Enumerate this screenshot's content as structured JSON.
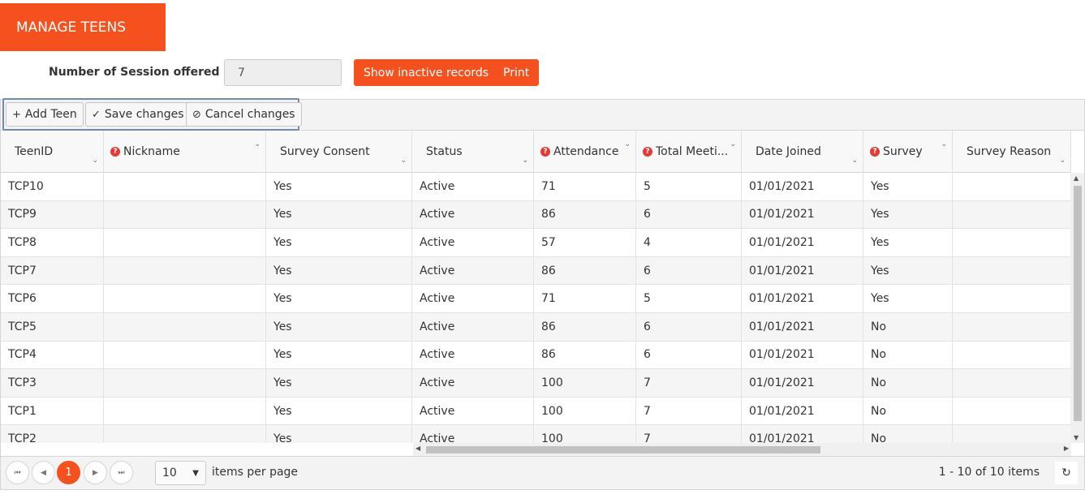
{
  "header": {
    "title": "MANAGE TEENS"
  },
  "session": {
    "label": "Number of Session offered",
    "value": "7"
  },
  "actions": {
    "show_inactive": "Show inactive records",
    "print": "Print"
  },
  "toolbar": {
    "add": "Add Teen",
    "save": "Save changes",
    "cancel": "Cancel changes"
  },
  "columns": [
    {
      "label": "TeenID",
      "required": false
    },
    {
      "label": "Nickname",
      "required": true
    },
    {
      "label": "Survey Consent",
      "required": false
    },
    {
      "label": "Status",
      "required": false
    },
    {
      "label": "Attendance",
      "required": true
    },
    {
      "label": "Total Meeti...",
      "required": true
    },
    {
      "label": "Date Joined",
      "required": false
    },
    {
      "label": "Survey",
      "required": true
    },
    {
      "label": "Survey Reason",
      "required": false
    }
  ],
  "rows": [
    [
      "TCP10",
      "",
      "Yes",
      "Active",
      "71",
      "5",
      "01/01/2021",
      "Yes",
      ""
    ],
    [
      "TCP9",
      "",
      "Yes",
      "Active",
      "86",
      "6",
      "01/01/2021",
      "Yes",
      ""
    ],
    [
      "TCP8",
      "",
      "Yes",
      "Active",
      "57",
      "4",
      "01/01/2021",
      "Yes",
      ""
    ],
    [
      "TCP7",
      "",
      "Yes",
      "Active",
      "86",
      "6",
      "01/01/2021",
      "Yes",
      ""
    ],
    [
      "TCP6",
      "",
      "Yes",
      "Active",
      "71",
      "5",
      "01/01/2021",
      "Yes",
      ""
    ],
    [
      "TCP5",
      "",
      "Yes",
      "Active",
      "86",
      "6",
      "01/01/2021",
      "No",
      ""
    ],
    [
      "TCP4",
      "",
      "Yes",
      "Active",
      "86",
      "6",
      "01/01/2021",
      "No",
      ""
    ],
    [
      "TCP3",
      "",
      "Yes",
      "Active",
      "100",
      "7",
      "01/01/2021",
      "No",
      ""
    ],
    [
      "TCP1",
      "",
      "Yes",
      "Active",
      "100",
      "7",
      "01/01/2021",
      "No",
      ""
    ],
    [
      "TCP2",
      "",
      "Yes",
      "Active",
      "100",
      "7",
      "01/01/2021",
      "No",
      ""
    ]
  ],
  "pager": {
    "current_page": "1",
    "page_size": "10",
    "items_label": "items per page",
    "info": "1 - 10 of 10 items"
  },
  "colors": {
    "accent": "#f4511e",
    "required_icon": "#e53935",
    "toolbar_focus": "#6f8bb5"
  }
}
